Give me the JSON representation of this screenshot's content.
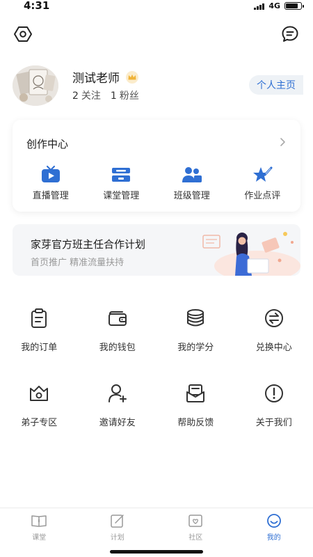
{
  "status_bar": {
    "time": "4:31",
    "network": "4G",
    "battery_level": 0.8
  },
  "header": {
    "settings_icon": "settings-hexagon-icon",
    "message_icon": "chat-bubble-icon"
  },
  "profile": {
    "name": "测试老师",
    "badge_icon": "crown-icon",
    "following_count": "2",
    "following_label": "关注",
    "fans_count": "1",
    "fans_label": "粉丝",
    "homepage_label": "个人主页"
  },
  "creation_center": {
    "title": "创作中心",
    "items": [
      {
        "label": "直播管理",
        "icon": "tv-icon"
      },
      {
        "label": "课堂管理",
        "icon": "classroom-icon"
      },
      {
        "label": "班级管理",
        "icon": "class-members-icon"
      },
      {
        "label": "作业点评",
        "icon": "star-pen-icon"
      }
    ]
  },
  "banner": {
    "title": "家芽官方班主任合作计划",
    "subtitle": "首页推广 精准流量扶持"
  },
  "menu": {
    "items": [
      {
        "label": "我的订单",
        "icon": "clipboard-icon"
      },
      {
        "label": "我的钱包",
        "icon": "wallet-icon"
      },
      {
        "label": "我的学分",
        "icon": "coins-stack-icon"
      },
      {
        "label": "兑换中心",
        "icon": "exchange-icon"
      },
      {
        "label": "弟子专区",
        "icon": "crown-camera-icon"
      },
      {
        "label": "邀请好友",
        "icon": "add-user-icon"
      },
      {
        "label": "帮助反馈",
        "icon": "envelope-icon"
      },
      {
        "label": "关于我们",
        "icon": "info-circle-icon"
      }
    ]
  },
  "tabbar": {
    "tabs": [
      {
        "label": "课堂",
        "icon": "book-icon",
        "active": false
      },
      {
        "label": "计划",
        "icon": "edit-plan-icon",
        "active": false
      },
      {
        "label": "社区",
        "icon": "community-icon",
        "active": false
      },
      {
        "label": "我的",
        "icon": "smile-face-icon",
        "active": true
      }
    ]
  },
  "colors": {
    "accent": "#2f6fd3",
    "text_primary": "#1a1a1a",
    "text_secondary": "#999999"
  }
}
